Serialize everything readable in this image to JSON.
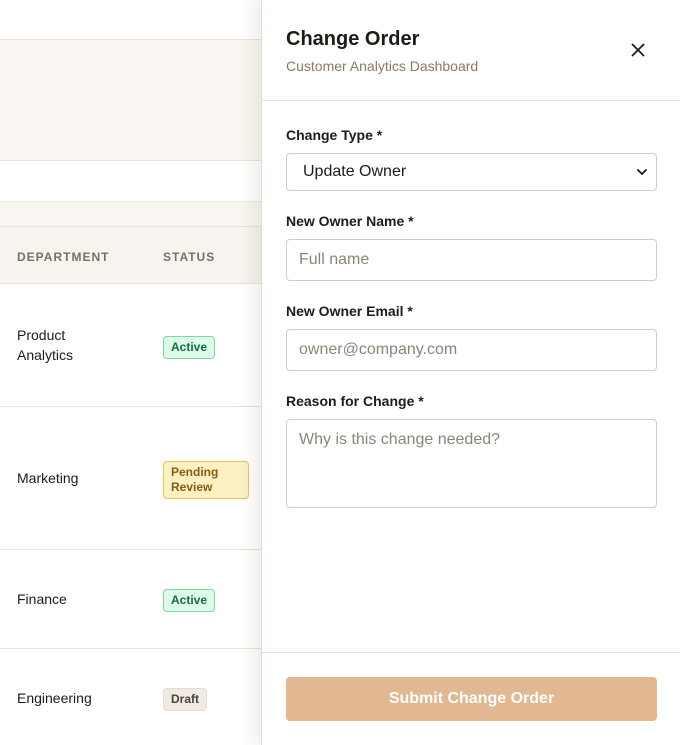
{
  "background": {
    "table": {
      "headers": {
        "department": "DEPARTMENT",
        "status": "STATUS"
      },
      "rows": [
        {
          "department": "Product Analytics",
          "status": "Active",
          "status_kind": "active"
        },
        {
          "department": "Marketing",
          "status": "Pending Review",
          "status_kind": "pending"
        },
        {
          "department": "Finance",
          "status": "Active",
          "status_kind": "active"
        },
        {
          "department": "Engineering",
          "status": "Draft",
          "status_kind": "draft"
        }
      ]
    }
  },
  "panel": {
    "title": "Change Order",
    "subtitle": "Customer Analytics Dashboard",
    "close_icon": "close-icon",
    "form": {
      "change_type": {
        "label": "Change Type *",
        "value": "Update Owner",
        "icon": "chevron-down-icon"
      },
      "new_owner_name": {
        "label": "New Owner Name *",
        "value": "",
        "placeholder": "Full name"
      },
      "new_owner_email": {
        "label": "New Owner Email *",
        "value": "",
        "placeholder": "owner@company.com"
      },
      "reason": {
        "label": "Reason for Change *",
        "value": "",
        "placeholder": "Why is this change needed?"
      }
    },
    "submit_label": "Submit Change Order"
  },
  "colors": {
    "accent": "#e2b891",
    "active_badge_bg": "#dcfbe9",
    "pending_badge_bg": "#fdf1c4",
    "draft_badge_bg": "#efebe4"
  }
}
